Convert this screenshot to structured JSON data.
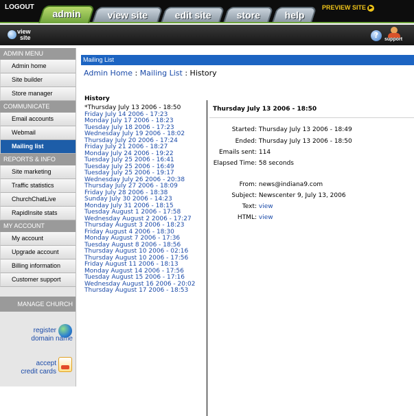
{
  "topbar": {
    "logout": "LOGOUT",
    "tabs": {
      "admin": "admin",
      "view_site": "view site",
      "edit_site": "edit site",
      "store": "store",
      "help": "help"
    },
    "preview": "PREVIEW SITE",
    "accent_color": "#6ea33c"
  },
  "subbar": {
    "logo_line1": "view",
    "logo_line2": "site",
    "help_glyph": "?",
    "support_label": "support"
  },
  "sidebar": {
    "admin_menu": "ADMIN MENU",
    "admin_items": [
      "Admin home",
      "Site builder",
      "Store manager"
    ],
    "communicate": "COMMUNICATE",
    "communicate_items": [
      "Email accounts",
      "Webmail",
      "Mailing list"
    ],
    "reports": "REPORTS & INFO",
    "reports_items": [
      "Site marketing",
      "Traffic statistics",
      "ChurchChatLive",
      "RapidInsite stats"
    ],
    "my_account": "MY ACCOUNT",
    "account_items": [
      "My account",
      "Upgrade account",
      "Billing information",
      "Customer support"
    ],
    "manage_church": "MANAGE CHURCH",
    "register_line1": "register",
    "register_line2": "domain name",
    "accept_line1": "accept",
    "accept_line2": "credit cards"
  },
  "main": {
    "header_bar": "Mailing List",
    "breadcrumb": {
      "home": "Admin Home",
      "sep": " : ",
      "mailing": "Mailing List",
      "current": "History"
    },
    "history_title": "History",
    "history": [
      "*Thursday July 13 2006 - 18:50",
      "Friday July 14 2006 - 17:23",
      "Monday July 17 2006 - 18:23",
      "Tuesday July 18 2006 - 17:23",
      "Wednesday July 19 2006 - 18:02",
      "Thursday July 20 2006 - 17:24",
      "Friday July 21 2006 - 18:27",
      "Monday July 24 2006 - 19:22",
      "Tuesday July 25 2006 - 16:41",
      "Tuesday July 25 2006 - 16:49",
      "Tuesday July 25 2006 - 19:17",
      "Wednesday July 26 2006 - 20:38",
      "Thursday July 27 2006 - 18:09",
      "Friday July 28 2006 - 18:38",
      "Sunday July 30 2006 - 14:23",
      "Monday July 31 2006 - 18:15",
      "Tuesday August 1 2006 - 17:58",
      "Wednesday August 2 2006 - 17:27",
      "Thursday August 3 2006 - 18:23",
      "Friday August 4 2006 - 18:30",
      "Monday August 7 2006 - 17:36",
      "Tuesday August 8 2006 - 18:56",
      "Thursday August 10 2006 - 02:16",
      "Thursday August 10 2006 - 17:56",
      "Friday August 11 2006 - 18:13",
      "Monday August 14 2006 - 17:56",
      "Tuesday August 15 2006 - 17:16",
      "Wednesday August 16 2006 - 20:02",
      "Thursday August 17 2006 - 18:53"
    ],
    "detail": {
      "title": "Thursday July 13 2006 - 18:50",
      "started_label": "Started:",
      "started": "Thursday July 13 2006 - 18:49",
      "ended_label": "Ended:",
      "ended": "Thursday July 13 2006 - 18:50",
      "emails_label": "Emails sent:",
      "emails": "114",
      "elapsed_label": "Elapsed Time:",
      "elapsed": "58 seconds",
      "from_label": "From:",
      "from": "news@indiana9.com",
      "subject_label": "Subject:",
      "subject": "Newscenter 9, July 13, 2006",
      "text_label": "Text:",
      "text_link": "view",
      "html_label": "HTML:",
      "html_link": "view"
    }
  }
}
